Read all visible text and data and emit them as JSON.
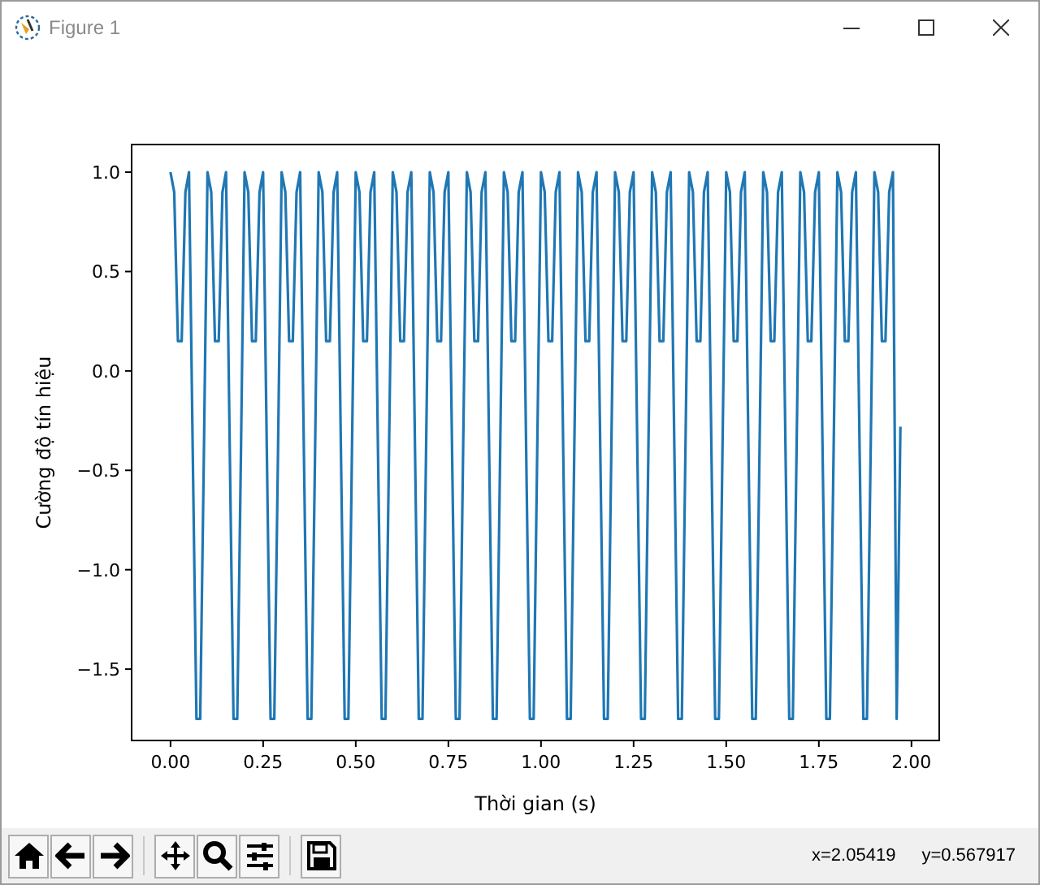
{
  "window": {
    "title": "Figure 1",
    "controls": [
      {
        "kind": "minimize"
      },
      {
        "kind": "maximize"
      },
      {
        "kind": "close"
      }
    ]
  },
  "figure": {
    "chart_data": {
      "type": "line",
      "xlabel": "Thời gian (s)",
      "ylabel": "Cường độ tín hiệu",
      "xlim": [
        -0.105,
        2.075
      ],
      "ylim": [
        -1.859,
        1.139
      ],
      "xticks": [
        {
          "value": 0,
          "label": "0.00"
        },
        {
          "value": 0.25,
          "label": "0.25"
        },
        {
          "value": 0.5,
          "label": "0.50"
        },
        {
          "value": 0.75,
          "label": "0.75"
        },
        {
          "value": 1,
          "label": "1.00"
        },
        {
          "value": 1.25,
          "label": "1.25"
        },
        {
          "value": 1.5,
          "label": "1.50"
        },
        {
          "value": 1.75,
          "label": "1.75"
        },
        {
          "value": 2,
          "label": "2.00"
        }
      ],
      "yticks": [
        {
          "value": 1,
          "label": "1.0"
        },
        {
          "value": 0.5,
          "label": "0.5"
        },
        {
          "value": 0,
          "label": "0.0"
        },
        {
          "value": -0.5,
          "label": "−0.5"
        },
        {
          "value": -1,
          "label": "−1.0"
        },
        {
          "value": -1.5,
          "label": "−1.5"
        }
      ],
      "x": [
        0,
        0.01,
        0.02,
        0.03,
        0.04,
        0.05,
        0.06,
        0.07,
        0.08,
        0.09,
        0.1,
        0.11,
        0.12,
        0.13,
        0.14,
        0.15,
        0.16,
        0.17,
        0.18,
        0.19,
        0.2,
        0.21,
        0.22,
        0.23,
        0.24,
        0.25,
        0.26,
        0.27,
        0.28,
        0.29,
        0.3,
        0.31,
        0.32,
        0.33,
        0.34,
        0.35,
        0.36,
        0.37,
        0.38,
        0.39,
        0.4,
        0.41,
        0.42,
        0.43,
        0.44,
        0.45,
        0.46,
        0.47,
        0.48,
        0.49,
        0.5,
        0.51,
        0.52,
        0.53,
        0.54,
        0.55,
        0.56,
        0.57,
        0.58,
        0.59,
        0.6,
        0.61,
        0.62,
        0.63,
        0.64,
        0.65,
        0.66,
        0.67,
        0.68,
        0.69,
        0.7,
        0.71,
        0.72,
        0.73,
        0.74,
        0.75,
        0.76,
        0.77,
        0.78,
        0.79,
        0.8,
        0.81,
        0.82,
        0.83,
        0.84,
        0.85,
        0.86,
        0.87,
        0.88,
        0.89,
        0.9,
        0.91,
        0.92,
        0.93,
        0.94,
        0.95,
        0.96,
        0.97,
        0.98,
        0.99,
        1,
        1.01,
        1.02,
        1.03,
        1.04,
        1.05,
        1.06,
        1.07,
        1.08,
        1.09,
        1.1,
        1.11,
        1.12,
        1.13,
        1.14,
        1.15,
        1.16,
        1.17,
        1.18,
        1.19,
        1.2,
        1.21,
        1.22,
        1.23,
        1.24,
        1.25,
        1.26,
        1.27,
        1.28,
        1.29,
        1.3,
        1.31,
        1.32,
        1.33,
        1.34,
        1.35,
        1.36,
        1.37,
        1.38,
        1.39,
        1.4,
        1.41,
        1.42,
        1.43,
        1.44,
        1.45,
        1.46,
        1.47,
        1.48,
        1.49,
        1.5,
        1.51,
        1.52,
        1.53,
        1.54,
        1.55,
        1.56,
        1.57,
        1.58,
        1.59,
        1.6,
        1.61,
        1.62,
        1.63,
        1.64,
        1.65,
        1.66,
        1.67,
        1.68,
        1.69,
        1.7,
        1.71,
        1.72,
        1.73,
        1.74,
        1.75,
        1.76,
        1.77,
        1.78,
        1.79,
        1.8,
        1.81,
        1.82,
        1.83,
        1.84,
        1.85,
        1.86,
        1.87,
        1.88,
        1.89,
        1.9,
        1.91,
        1.92,
        1.93,
        1.94,
        1.95,
        1.96,
        1.97
      ],
      "series": [
        {
          "color": "#1f77b4",
          "values": [
            1,
            0.9,
            0.15,
            0.15,
            0.9,
            1,
            -0.4,
            -1.75,
            -1.75,
            -0.4,
            1,
            0.9,
            0.15,
            0.15,
            0.9,
            1,
            -0.4,
            -1.75,
            -1.75,
            -0.4,
            1,
            0.9,
            0.15,
            0.15,
            0.9,
            1,
            -0.4,
            -1.75,
            -1.75,
            -0.4,
            1,
            0.9,
            0.15,
            0.15,
            0.9,
            1,
            -0.4,
            -1.75,
            -1.75,
            -0.4,
            1,
            0.9,
            0.15,
            0.15,
            0.9,
            1,
            -0.4,
            -1.75,
            -1.75,
            -0.4,
            1,
            0.9,
            0.15,
            0.15,
            0.9,
            1,
            -0.4,
            -1.75,
            -1.75,
            -0.4,
            1,
            0.9,
            0.15,
            0.15,
            0.9,
            1,
            -0.4,
            -1.75,
            -1.75,
            -0.4,
            1,
            0.9,
            0.15,
            0.15,
            0.9,
            1,
            -0.4,
            -1.75,
            -1.75,
            -0.4,
            1,
            0.9,
            0.15,
            0.15,
            0.9,
            1,
            -0.4,
            -1.75,
            -1.75,
            -0.4,
            1,
            0.9,
            0.15,
            0.15,
            0.9,
            1,
            -0.4,
            -1.75,
            -1.75,
            -0.4,
            1,
            0.9,
            0.15,
            0.15,
            0.9,
            1,
            -0.4,
            -1.75,
            -1.75,
            -0.4,
            1,
            0.9,
            0.15,
            0.15,
            0.9,
            1,
            -0.4,
            -1.75,
            -1.75,
            -0.4,
            1,
            0.9,
            0.15,
            0.15,
            0.9,
            1,
            -0.4,
            -1.75,
            -1.75,
            -0.4,
            1,
            0.9,
            0.15,
            0.15,
            0.9,
            1,
            -0.4,
            -1.75,
            -1.75,
            -0.4,
            1,
            0.9,
            0.15,
            0.15,
            0.9,
            1,
            -0.4,
            -1.75,
            -1.75,
            -0.4,
            1,
            0.9,
            0.15,
            0.15,
            0.9,
            1,
            -0.4,
            -1.75,
            -1.75,
            -0.4,
            1,
            0.9,
            0.15,
            0.15,
            0.9,
            1,
            -0.4,
            -1.75,
            -1.75,
            -0.4,
            1,
            0.9,
            0.15,
            0.15,
            0.9,
            1,
            -0.4,
            -1.75,
            -1.75,
            -0.4,
            1,
            0.9,
            0.15,
            0.15,
            0.9,
            1,
            -0.4,
            -1.75,
            -1.75,
            -0.4,
            1,
            0.9,
            0.15,
            0.15,
            0.9,
            1,
            -1.75,
            -0.28
          ]
        }
      ]
    }
  },
  "toolbar": {
    "buttons": [
      {
        "kind": "home"
      },
      {
        "kind": "back"
      },
      {
        "kind": "forward"
      },
      {
        "kind": "separator"
      },
      {
        "kind": "pan"
      },
      {
        "kind": "zoom"
      },
      {
        "kind": "configure"
      },
      {
        "kind": "separator"
      },
      {
        "kind": "save"
      }
    ],
    "coordinates": [
      "x=2.05419",
      "y=0.567917"
    ]
  }
}
